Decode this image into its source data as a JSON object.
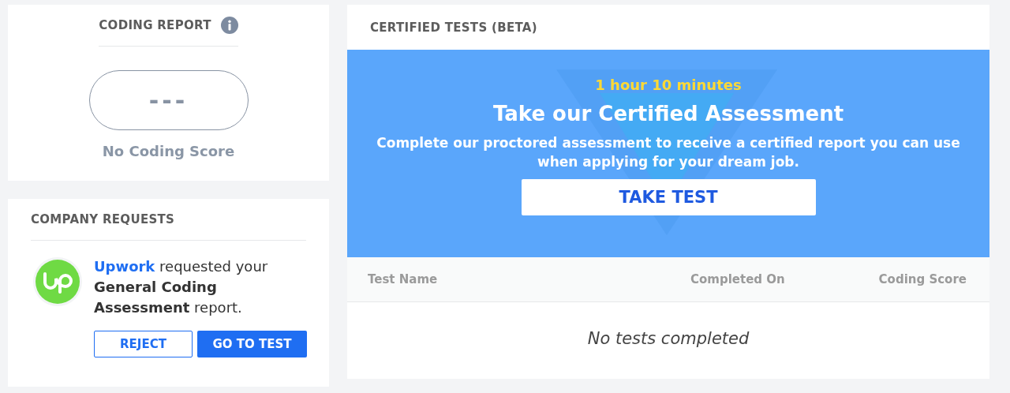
{
  "coding_report": {
    "title": "CODING REPORT",
    "score": "---",
    "score_label": "No Coding Score"
  },
  "company_requests": {
    "title": "COMPANY REQUESTS",
    "requests": [
      {
        "company": "Upwork",
        "message": "requested your **General Coding Assessment** report.",
        "buttons": [
          {
            "label": "REJECT",
            "kind": "outline"
          },
          {
            "label": "GO TO TEST",
            "kind": "primary"
          }
        ]
      }
    ]
  },
  "certified_tests": {
    "title": "CERTIFIED TESTS (BETA)",
    "banner": {
      "duration": "1 hour 10 minutes",
      "heading": "Take our Certified Assessment",
      "description": "Complete our proctored assessment to receive a certified report you can use when applying for your dream job.",
      "button": "TAKE TEST"
    },
    "table": {
      "columns": [
        "Test Name",
        "Completed On",
        "Coding Score"
      ],
      "empty_message": "No tests completed"
    }
  }
}
